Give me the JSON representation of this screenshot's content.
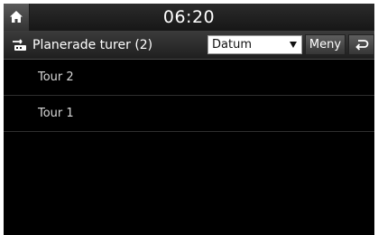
{
  "status_bar": {
    "home_icon": "home-icon",
    "time": "06:20"
  },
  "title_bar": {
    "icon": "routes-icon",
    "title": "Planerade turer (2)",
    "sort_select": {
      "value": "Datum"
    },
    "menu_label": "Meny",
    "back_icon": "back-arrow-icon"
  },
  "routes": [
    {
      "label": "Tour 2"
    },
    {
      "label": "Tour 1"
    }
  ],
  "colors": {
    "background": "#000000",
    "text": "#e8e8e8",
    "button": "#4a4a4a"
  }
}
